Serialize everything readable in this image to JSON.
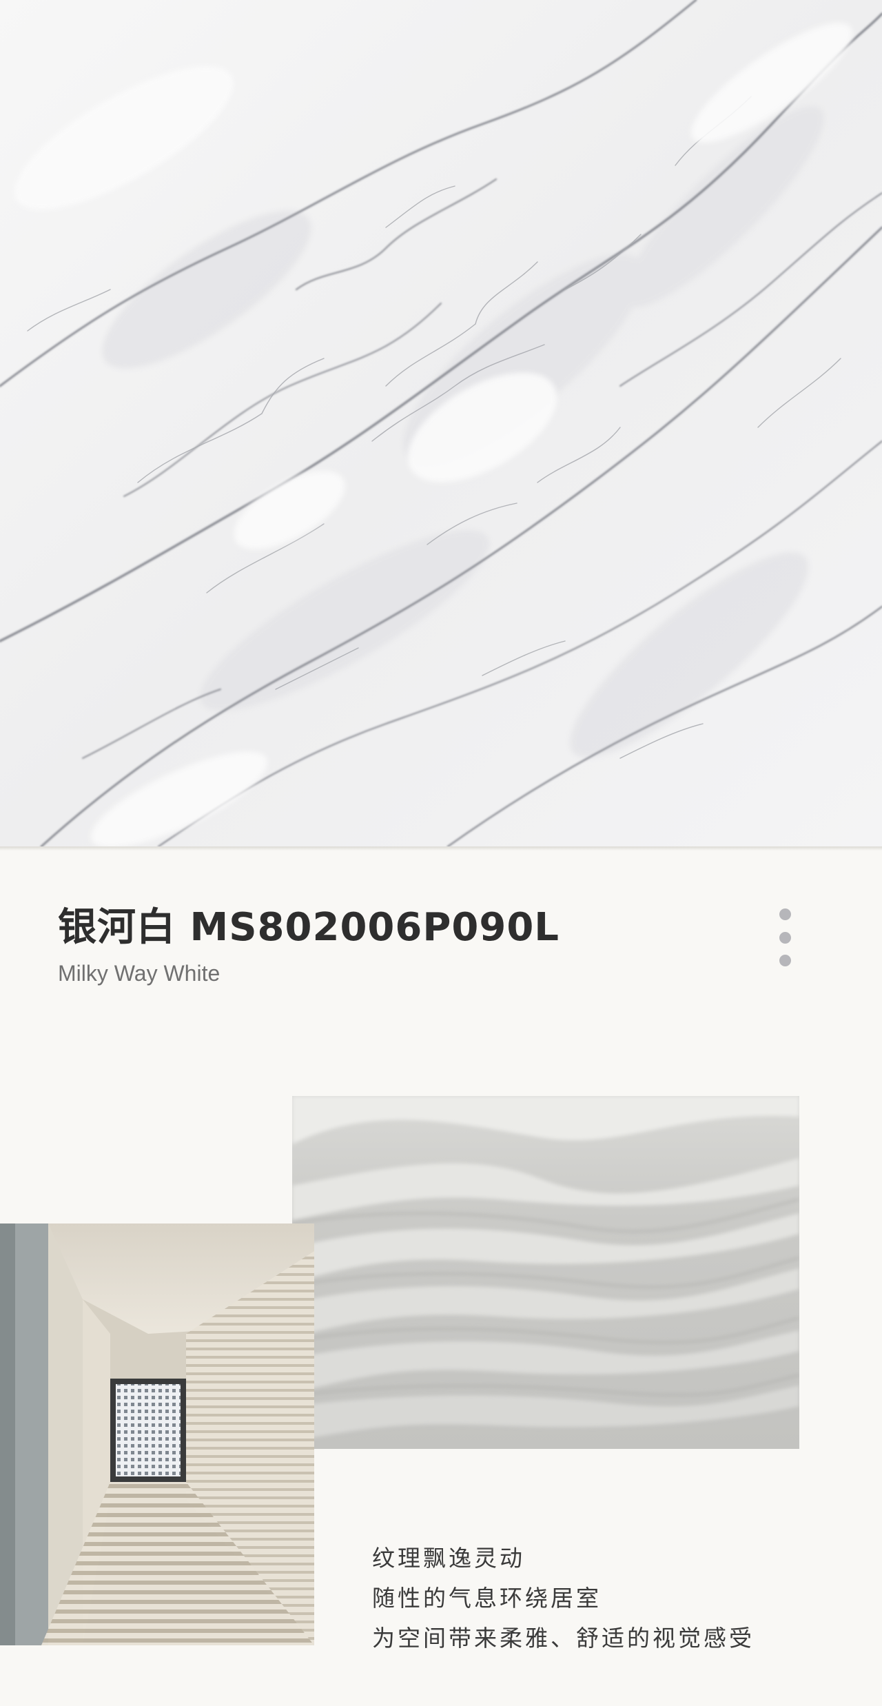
{
  "product": {
    "title": "银河白 MS802006P090L",
    "subtitle": "Milky Way White"
  },
  "menu": {
    "icon": "more-vertical-icon"
  },
  "caption": {
    "lines": [
      "纹理飘逸灵动",
      "随性的气息环绕居室",
      "为空间带来柔雅、舒适的视觉感受"
    ]
  },
  "colors": {
    "background": "#f9f8f5",
    "title": "#2e2e2e",
    "subtitle": "#707070",
    "menu_dots": "#b6b6ba"
  }
}
